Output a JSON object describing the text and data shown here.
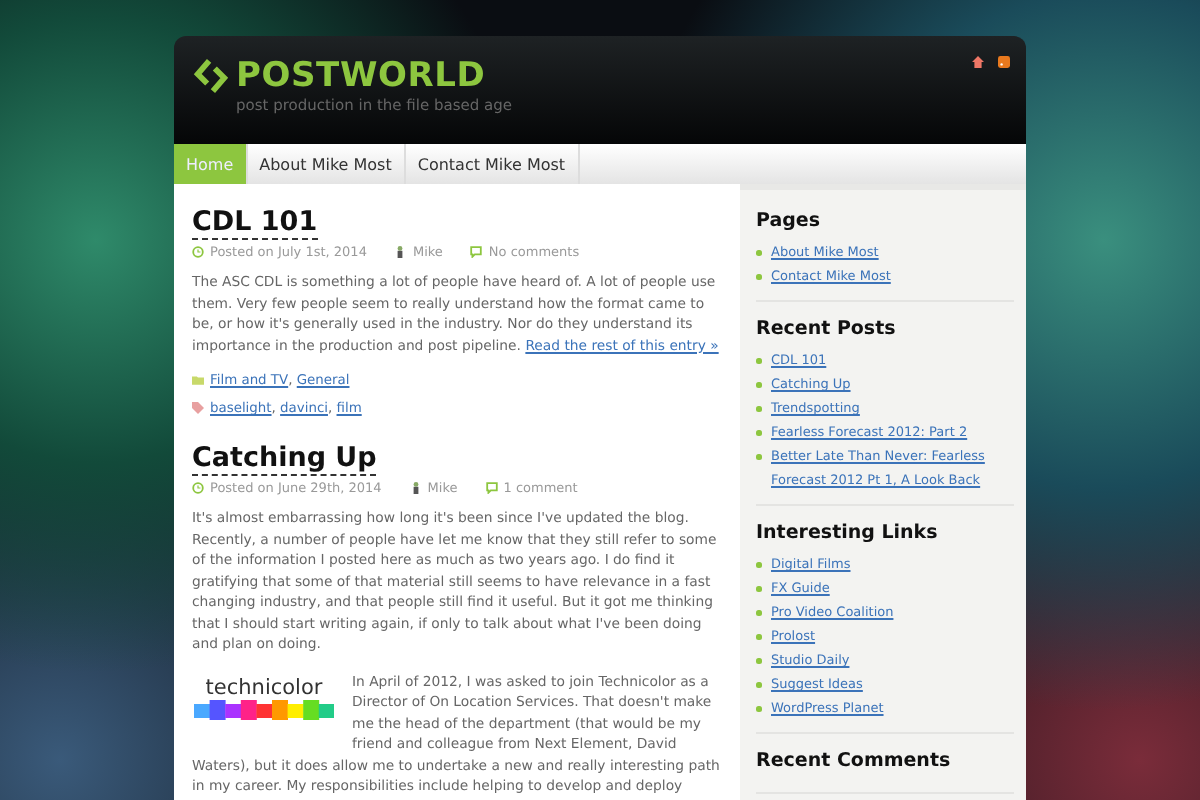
{
  "site": {
    "title": "POSTWORLD",
    "tagline": "post production in the file based age"
  },
  "nav": [
    {
      "label": "Home",
      "selected": true
    },
    {
      "label": "About Mike Most",
      "selected": false
    },
    {
      "label": "Contact Mike Most",
      "selected": false
    }
  ],
  "posts": [
    {
      "title": "CDL 101",
      "date": "Posted on July 1st, 2014",
      "author": "Mike",
      "comments": "No comments",
      "paragraphs": [
        {
          "text": "The ASC CDL is something a lot of people have heard of. A lot of people use them. Very few people seem to really understand how the format came to be, or how it's generally used in the industry. Nor do they understand its importance in the production and post pipeline.",
          "more": "Read the rest of this entry »"
        }
      ],
      "categories": [
        "Film and TV",
        "General"
      ],
      "tags": [
        "baselight",
        "davinci",
        "film"
      ],
      "separator": ","
    },
    {
      "title": "Catching Up",
      "date": "Posted on June 29th, 2014",
      "author": "Mike",
      "comments": "1 comment",
      "paragraphs": [
        {
          "text": "It's almost embarrassing how long it's been since I've updated the blog. Recently, a number of people have let me know that they still refer to some of the information I posted here as much as two years ago. I do find it gratifying that some of that material still seems to have relevance in a fast changing industry, and that people still find it useful. But it got me thinking that I should start writing again, if only to talk about what I've been doing and plan on doing."
        },
        {
          "logo": "technicolor",
          "text": "In April of 2012, I was asked to join Technicolor as a Director of On Location Services. That doesn't make me the head of the department (that would be my friend and colleague from Next Element, David",
          "text_below": "Waters), but it does allow me to undertake a new and really interesting path in my career. My responsibilities include helping to develop and deploy"
        }
      ]
    }
  ],
  "sidebar": [
    {
      "title": "Pages",
      "items": [
        "About Mike Most",
        "Contact Mike Most"
      ]
    },
    {
      "title": "Recent Posts",
      "items": [
        "CDL 101",
        "Catching Up",
        "Trendspotting",
        "Fearless Forecast 2012: Part 2",
        "Better Late Than Never: Fearless Forecast 2012 Pt 1, A Look Back"
      ]
    },
    {
      "title": "Interesting Links",
      "items": [
        "Digital Films",
        "FX Guide",
        "Pro Video Coalition",
        "Prolost",
        "Studio Daily",
        "Suggest Ideas",
        "WordPress Planet"
      ]
    },
    {
      "title": "Recent Comments"
    }
  ]
}
